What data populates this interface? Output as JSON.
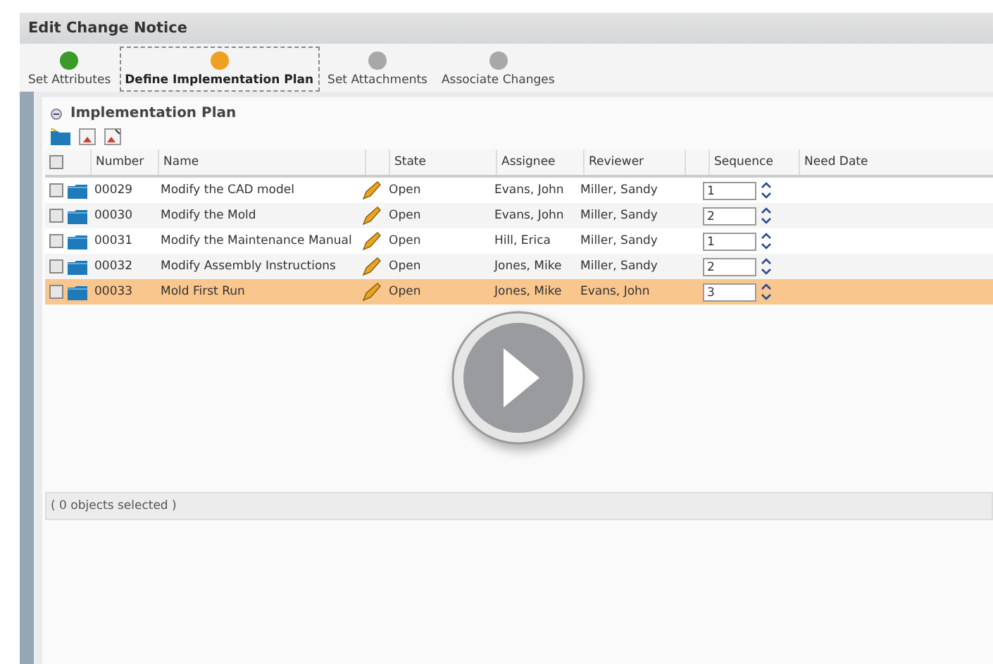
{
  "window": {
    "title": "Edit Change Notice"
  },
  "steps": [
    {
      "label": "Set Attributes",
      "color": "#3a9a2a",
      "selected": false
    },
    {
      "label": "Define Implementation Plan",
      "color": "#f0a020",
      "selected": true
    },
    {
      "label": "Set Attachments",
      "color": "#a8a8a8",
      "selected": false
    },
    {
      "label": "Associate Changes",
      "color": "#a8a8a8",
      "selected": false
    }
  ],
  "panel": {
    "title": "Implementation Plan",
    "expanded": true
  },
  "table": {
    "all_checked": false,
    "columns": [
      "Number",
      "Name",
      "State",
      "Assignee",
      "Reviewer",
      "Sequence",
      "Need Date"
    ],
    "rows": [
      {
        "number": "00029",
        "name": "Modify the CAD model",
        "state": "Open",
        "assignee": "Evans, John",
        "reviewer": "Miller, Sandy",
        "sequence": "1",
        "checked": false,
        "selected": false
      },
      {
        "number": "00030",
        "name": "Modify the Mold",
        "state": "Open",
        "assignee": "Evans, John",
        "reviewer": "Miller, Sandy",
        "sequence": "2",
        "checked": false,
        "selected": false
      },
      {
        "number": "00031",
        "name": "Modify the Maintenance Manual",
        "state": "Open",
        "assignee": "Hill, Erica",
        "reviewer": "Miller, Sandy",
        "sequence": "1",
        "checked": false,
        "selected": false
      },
      {
        "number": "00032",
        "name": "Modify Assembly Instructions",
        "state": "Open",
        "assignee": "Jones, Mike",
        "reviewer": "Miller, Sandy",
        "sequence": "2",
        "checked": false,
        "selected": false
      },
      {
        "number": "00033",
        "name": "Mold First Run",
        "state": "Open",
        "assignee": "Jones, Mike",
        "reviewer": "Evans, John",
        "sequence": "3",
        "checked": false,
        "selected": true
      }
    ]
  },
  "status_bar": "( 0 objects selected )"
}
